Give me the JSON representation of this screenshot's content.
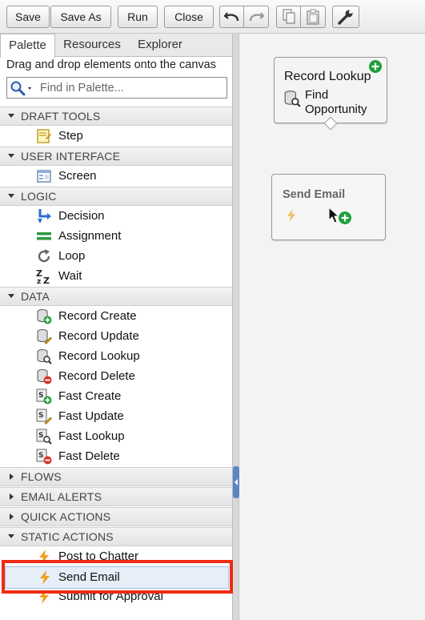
{
  "toolbar": {
    "save": "Save",
    "save_as": "Save As",
    "run": "Run",
    "close": "Close"
  },
  "tabs": [
    {
      "label": "Palette",
      "active": true
    },
    {
      "label": "Resources",
      "active": false
    },
    {
      "label": "Explorer",
      "active": false
    }
  ],
  "palette": {
    "hint": "Drag and drop elements onto the canvas",
    "search_placeholder": "Find in Palette...",
    "categories": {
      "draft_tools": "DRAFT TOOLS",
      "user_interface": "USER INTERFACE",
      "logic": "LOGIC",
      "data": "DATA",
      "flows": "FLOWS",
      "email_alerts": "EMAIL ALERTS",
      "quick_actions": "QUICK ACTIONS",
      "static_actions": "STATIC ACTIONS"
    },
    "items": {
      "step": "Step",
      "screen": "Screen",
      "decision": "Decision",
      "assignment": "Assignment",
      "loop": "Loop",
      "wait": "Wait",
      "record_create": "Record Create",
      "record_update": "Record Update",
      "record_lookup": "Record Lookup",
      "record_delete": "Record Delete",
      "fast_create": "Fast Create",
      "fast_update": "Fast Update",
      "fast_lookup": "Fast Lookup",
      "fast_delete": "Fast Delete",
      "post_to_chatter": "Post to Chatter",
      "send_email": "Send Email",
      "submit_for_approval": "Submit for Approval"
    },
    "selected_item": "Send Email"
  },
  "canvas": {
    "node1": {
      "title": "Record Lookup",
      "subtitle": "Find Opportunity"
    },
    "node2": {
      "title": "Send Email"
    }
  },
  "colors": {
    "highlight": "#f12b11",
    "add_green": "#1f9e3a",
    "bolt_orange": "#f0a020",
    "selected_bg": "#e6eef8"
  }
}
